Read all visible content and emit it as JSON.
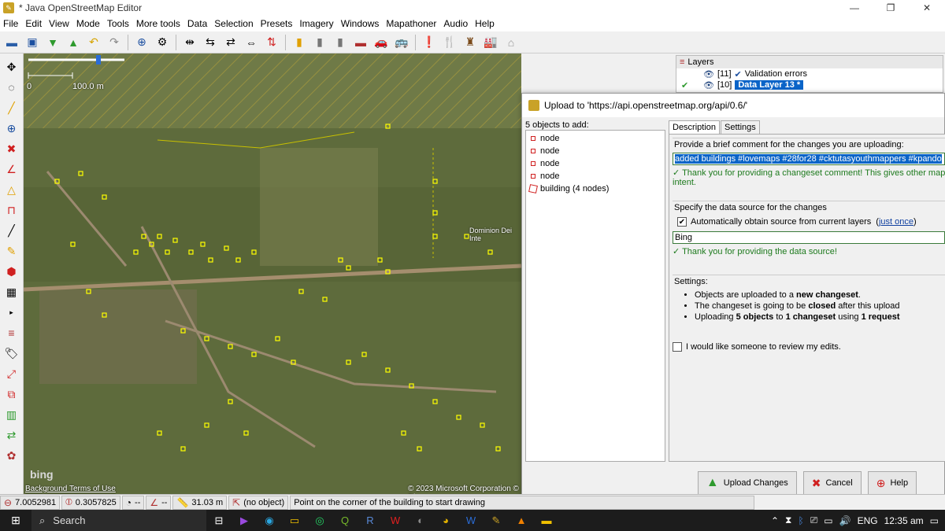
{
  "window": {
    "title": "* Java OpenStreetMap Editor",
    "minimize": "—",
    "maximize": "❐",
    "close": "✕"
  },
  "menu": [
    "File",
    "Edit",
    "View",
    "Mode",
    "Tools",
    "More tools",
    "Data",
    "Selection",
    "Presets",
    "Imagery",
    "Windows",
    "Mapathoner",
    "Audio",
    "Help"
  ],
  "map": {
    "scale_zero": "0",
    "scale_label": "100.0 m",
    "bing": "bing",
    "background_terms": "Background Terms of Use",
    "copyright": "© 2023 Microsoft Corporation © 2(",
    "place": "Dominion Dei Inte"
  },
  "layers": {
    "title": "Layers",
    "rows": [
      {
        "index": "[11]",
        "name": "Validation errors",
        "selected": false
      },
      {
        "index": "[10]",
        "name": "Data Layer 13 *",
        "selected": true
      }
    ]
  },
  "dialog": {
    "title": "Upload to 'https://api.openstreetmap.org/api/0.6/'",
    "objects_title": "5 objects to add:",
    "objects": [
      {
        "type": "node",
        "label": "node"
      },
      {
        "type": "node",
        "label": "node"
      },
      {
        "type": "node",
        "label": "node"
      },
      {
        "type": "node",
        "label": "node"
      },
      {
        "type": "building",
        "label": "building (4 nodes)"
      }
    ],
    "tabs": [
      "Description",
      "Settings"
    ],
    "comment_label": "Provide a brief comment for the changes you are uploading:",
    "comment_value": "added buildings #lovemaps #28for28 #cktutasyouthmappers #kpando",
    "comment_ok": "✓ Thank you for providing a changeset comment! This gives other mappers a better understanding of your intent.",
    "comment_ok_line1": "✓ Thank you for providing a changeset comment! This gives other mappers a bet",
    "comment_ok_line2": "intent.",
    "source_label": "Specify the data source for the changes",
    "auto_source_label": "Automatically obtain source from current layers",
    "just_once": "just once",
    "source_value": "Bing",
    "source_ok": "✓ Thank you for providing the data source!",
    "settings_label": "Settings:",
    "settings_items": [
      {
        "pre": "Objects are uploaded to a ",
        "bold": "new changeset",
        "post": "."
      },
      {
        "pre": "The changeset is going to be ",
        "bold": "closed",
        "post": " after this upload"
      },
      {
        "pre": "Uploading ",
        "bold": "5 objects",
        "post": " to "
      }
    ],
    "settings_item3_bold2": "1 changeset",
    "settings_item3_mid": " using ",
    "settings_item3_bold3": "1 request",
    "review_label": "I would like someone to review my edits.",
    "buttons": {
      "upload": "Upload Changes",
      "cancel": "Cancel",
      "help": "Help"
    }
  },
  "status": {
    "lat": "7.0052981",
    "lon": "0.3057825",
    "heading": "--",
    "angle": "--",
    "distance": "31.03 m",
    "object": "(no object)",
    "message": "Point on the corner of the building to start drawing"
  },
  "taskbar": {
    "search": "Search",
    "lang": "ENG",
    "time": "12:35 am"
  }
}
